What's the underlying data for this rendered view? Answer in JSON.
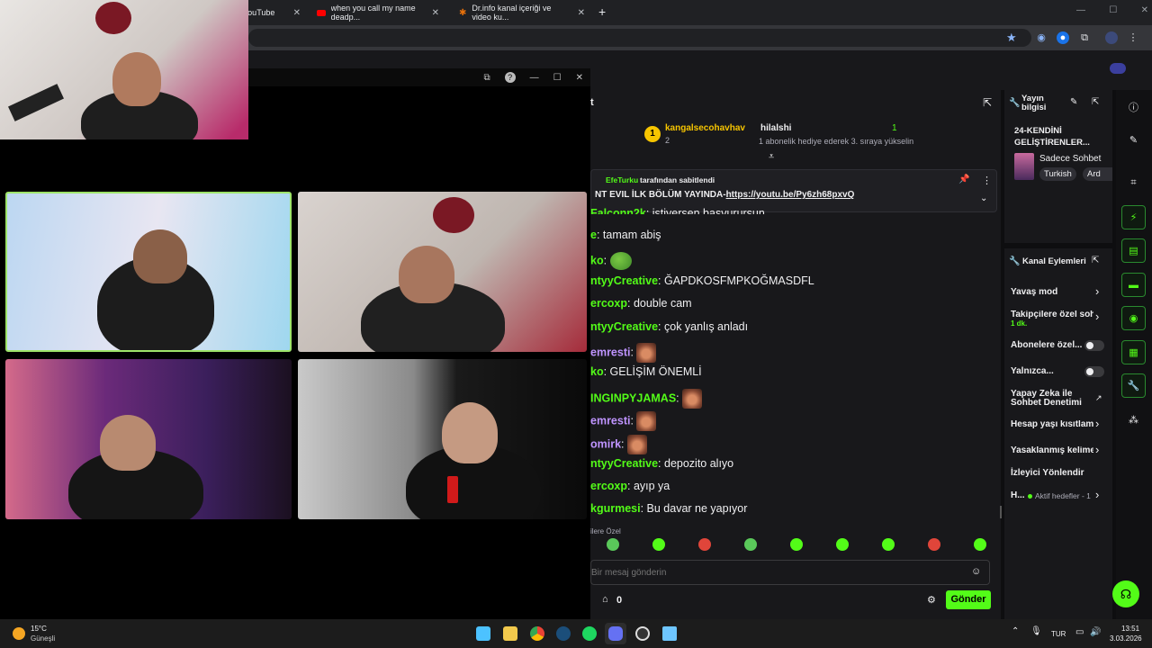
{
  "browser": {
    "tabs": [
      {
        "title": "YouTube"
      },
      {
        "title": "when you call my name deadp..."
      },
      {
        "title": "Dr.info kanal içeriği ve video ku..."
      }
    ],
    "new_tab": "+"
  },
  "call": {
    "window_controls": [
      "—",
      "☐",
      "✕"
    ]
  },
  "chat": {
    "header_short": "t",
    "leaderboard": {
      "first_user": "kangalsecohavhav",
      "first_badge": "1",
      "first_count": "2",
      "second_user": "hilalshi",
      "second_count": "1",
      "gift_text": "1 abonelik hediye ederek 3. sıraya yükselin"
    },
    "pinned": {
      "by_user": "EfeTurku",
      "by_text": "tarafından sabitlendi",
      "message_prefix": "NT EVIL İLK BÖLÜM YAYINDA-",
      "link": "https://youtu.be/Py6zh68pxvQ"
    },
    "messages": [
      {
        "user": "Falconn2k",
        "text": "istiyersen başvurursun",
        "color": "#53fc18"
      },
      {
        "user": "e",
        "text": "tamam abiş",
        "color": "#53fc18"
      },
      {
        "user": "ko",
        "text": "",
        "color": "#53fc18",
        "emote": "pepe"
      },
      {
        "user": "ntyyCreative",
        "text": "ĞAPDKOSFMPKOĞMASDFL",
        "color": "#53fc18"
      },
      {
        "user": "ercoxp",
        "text": "double cam",
        "color": "#53fc18"
      },
      {
        "user": "ntyyCreative",
        "text": "çok yanlış anladı",
        "color": "#53fc18"
      },
      {
        "user": "emresti",
        "text": "",
        "color": "#bf94ff",
        "emote": "face"
      },
      {
        "user": "ko",
        "text": "GELİŞİM ÖNEMLİ",
        "color": "#53fc18"
      },
      {
        "user": "INGINPYJAMAS",
        "text": "",
        "color": "#53fc18",
        "emote": "face"
      },
      {
        "user": "emresti",
        "text": "",
        "color": "#bf94ff",
        "emote": "face"
      },
      {
        "user": "omirk",
        "text": "",
        "color": "#bf94ff",
        "emote": "face"
      },
      {
        "user": "ntyyCreative",
        "text": "depozito alıyo",
        "color": "#53fc18"
      },
      {
        "user": "ercoxp",
        "text": "ayıp ya",
        "color": "#53fc18"
      },
      {
        "user": "kgurmesi",
        "text": "Bu davar ne yapıyor",
        "color": "#53fc18"
      }
    ],
    "emote_tab": "ilere Özel",
    "input_placeholder": "Bir mesaj gönderin",
    "points": "0",
    "send_label": "Gönder"
  },
  "stream_info": {
    "title": "Yayın bilgisi",
    "stream_title": "24-KENDİNİ GELİŞTİRENLER...",
    "category": "Sadece Sohbet",
    "tags": [
      "Turkish",
      "Ard"
    ]
  },
  "channel_actions": {
    "title": "Kanal Eylemleri",
    "slow_mode": "Yavaş mod",
    "followers_only": "Takipçilere özel soh",
    "followers_only_sub": "1 dk.",
    "subs_only": "Abonelere özel...",
    "emote_only": "Yalnızca...",
    "ai_moderation": "Yapay Zeka ile Sohbet Denetimi",
    "account_age": "Hesap yaşı kısıtlamı",
    "banned_words": "Yasaklanmış kelime",
    "raid": "İzleyici Yönlendir",
    "goals_label": "H...",
    "goals_sub": "Aktif hedefler - 1"
  },
  "taskbar": {
    "weather_temp": "15°C",
    "weather_text": "Güneşli",
    "language": "TUR",
    "time": "13:51",
    "date": "3.03.2026"
  },
  "colors": {
    "accent": "#53fc18",
    "chat_bg": "#18181b",
    "purple_user": "#bf94ff"
  }
}
